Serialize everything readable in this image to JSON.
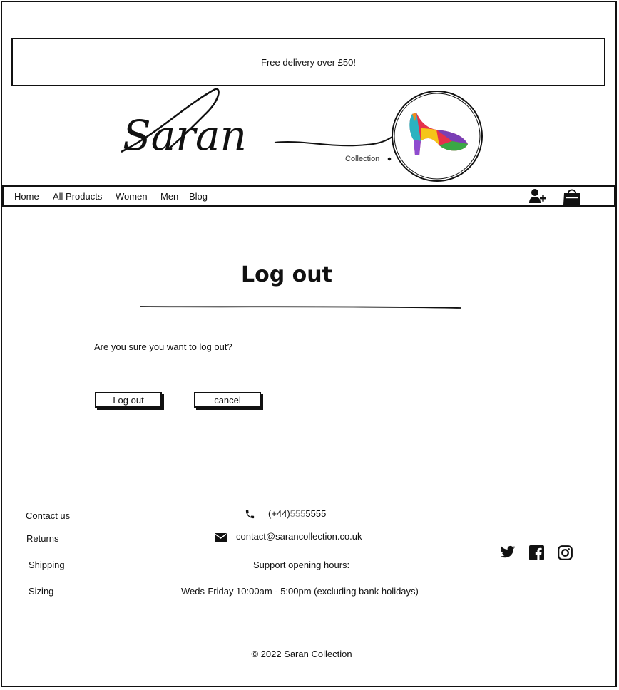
{
  "banner": {
    "text": "Free delivery over £50!"
  },
  "logo": {
    "script_text": "Saran",
    "subtext": "Collection"
  },
  "nav": {
    "items": [
      {
        "label": "Home"
      },
      {
        "label": "All Products"
      },
      {
        "label": "Women"
      },
      {
        "label": "Men"
      },
      {
        "label": "Blog"
      }
    ],
    "icons": [
      "add-user-icon",
      "shopping-bag-icon"
    ]
  },
  "main": {
    "title": "Log out",
    "question": "Are you sure you want to log out?",
    "logout_label": "Log out",
    "cancel_label": "cancel"
  },
  "footer": {
    "links": [
      "Contact us",
      "Returns",
      "Shipping",
      "Sizing"
    ],
    "phone_prefix": "(+44)",
    "phone_mid": "555",
    "phone_suffix": "5555",
    "email": "contact@sarancollection.co.uk",
    "hours_title": "Support opening hours:",
    "hours": "Weds-Friday 10:00am - 5:00pm (excluding bank holidays)",
    "social_icons": [
      "twitter-icon",
      "facebook-icon",
      "instagram-icon"
    ],
    "copyright": "© 2022 Saran Collection"
  }
}
